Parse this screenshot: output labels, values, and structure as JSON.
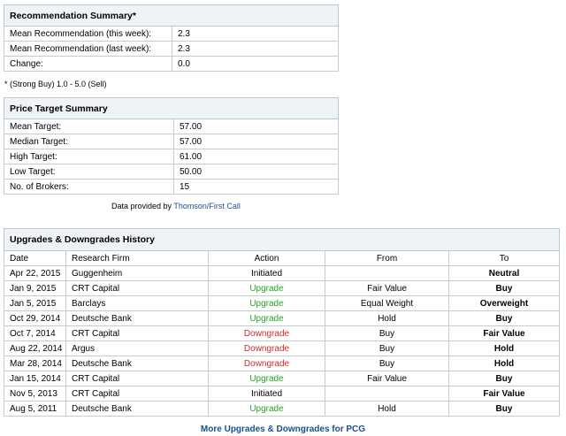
{
  "recommendation": {
    "title": "Recommendation Summary*",
    "rows": [
      {
        "label": "Mean Recommendation (this week):",
        "value": "2.3"
      },
      {
        "label": "Mean Recommendation (last week):",
        "value": "2.3"
      },
      {
        "label": "Change:",
        "value": "0.0"
      }
    ],
    "note": "* (Strong Buy) 1.0 - 5.0 (Sell)"
  },
  "price_target": {
    "title": "Price Target Summary",
    "rows": [
      {
        "label": "Mean Target:",
        "value": "57.00"
      },
      {
        "label": "Median Target:",
        "value": "57.00"
      },
      {
        "label": "High Target:",
        "value": "61.00"
      },
      {
        "label": "Low Target:",
        "value": "50.00"
      },
      {
        "label": "No. of Brokers:",
        "value": "15"
      }
    ],
    "credit_prefix": "Data provided by ",
    "credit_link": "Thomson/First Call"
  },
  "history": {
    "title": "Upgrades & Downgrades History",
    "columns": [
      "Date",
      "Research Firm",
      "Action",
      "From",
      "To"
    ],
    "rows": [
      {
        "date": "Apr 22, 2015",
        "firm": "Guggenheim",
        "action": "Initiated",
        "from": "",
        "to": "Neutral"
      },
      {
        "date": "Jan 9, 2015",
        "firm": "CRT Capital",
        "action": "Upgrade",
        "from": "Fair Value",
        "to": "Buy"
      },
      {
        "date": "Jan 5, 2015",
        "firm": "Barclays",
        "action": "Upgrade",
        "from": "Equal Weight",
        "to": "Overweight"
      },
      {
        "date": "Oct 29, 2014",
        "firm": "Deutsche Bank",
        "action": "Upgrade",
        "from": "Hold",
        "to": "Buy"
      },
      {
        "date": "Oct 7, 2014",
        "firm": "CRT Capital",
        "action": "Downgrade",
        "from": "Buy",
        "to": "Fair Value"
      },
      {
        "date": "Aug 22, 2014",
        "firm": "Argus",
        "action": "Downgrade",
        "from": "Buy",
        "to": "Hold"
      },
      {
        "date": "Mar 28, 2014",
        "firm": "Deutsche Bank",
        "action": "Downgrade",
        "from": "Buy",
        "to": "Hold"
      },
      {
        "date": "Jan 15, 2014",
        "firm": "CRT Capital",
        "action": "Upgrade",
        "from": "Fair Value",
        "to": "Buy"
      },
      {
        "date": "Nov 5, 2013",
        "firm": "CRT Capital",
        "action": "Initiated",
        "from": "",
        "to": "Fair Value"
      },
      {
        "date": "Aug 5, 2011",
        "firm": "Deutsche Bank",
        "action": "Upgrade",
        "from": "Hold",
        "to": "Buy"
      }
    ],
    "more_link": "More Upgrades & Downgrades for PCG"
  },
  "colors": {
    "upgrade": "#2aa12a",
    "downgrade": "#d42a2a",
    "header_bg": "#eef3f6",
    "link": "#1a4f8c"
  }
}
